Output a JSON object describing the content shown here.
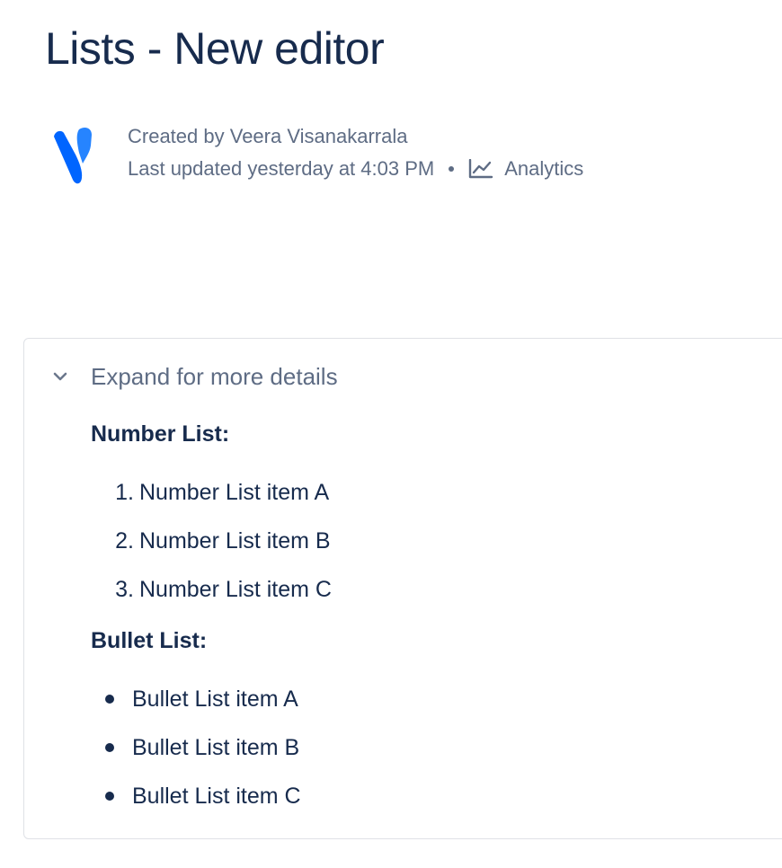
{
  "page": {
    "title": "Lists - New editor"
  },
  "byline": {
    "created_by": "Created by Veera Visanakarrala",
    "last_updated": "Last updated yesterday at 4:03 PM",
    "analytics_label": "Analytics"
  },
  "expand": {
    "title": "Expand for more details",
    "expanded": true
  },
  "number_list": {
    "heading": "Number List:",
    "items": [
      {
        "marker": "1.",
        "text": "Number List item A"
      },
      {
        "marker": "2.",
        "text": "Number List item B"
      },
      {
        "marker": "3.",
        "text": "Number List item C"
      }
    ]
  },
  "bullet_list": {
    "heading": "Bullet List:",
    "items": [
      {
        "text": "Bullet List item A"
      },
      {
        "text": "Bullet List item B"
      },
      {
        "text": "Bullet List item C"
      }
    ]
  },
  "icons": {
    "avatar": "avatar-logo-icon",
    "analytics": "analytics-chart-icon",
    "chevron": "chevron-down-icon"
  },
  "colors": {
    "text_primary": "#172b4d",
    "text_secondary": "#5e6c84",
    "border": "#dfe1e6",
    "avatar_blue": "#0065ff",
    "avatar_light_blue": "#2684ff"
  }
}
